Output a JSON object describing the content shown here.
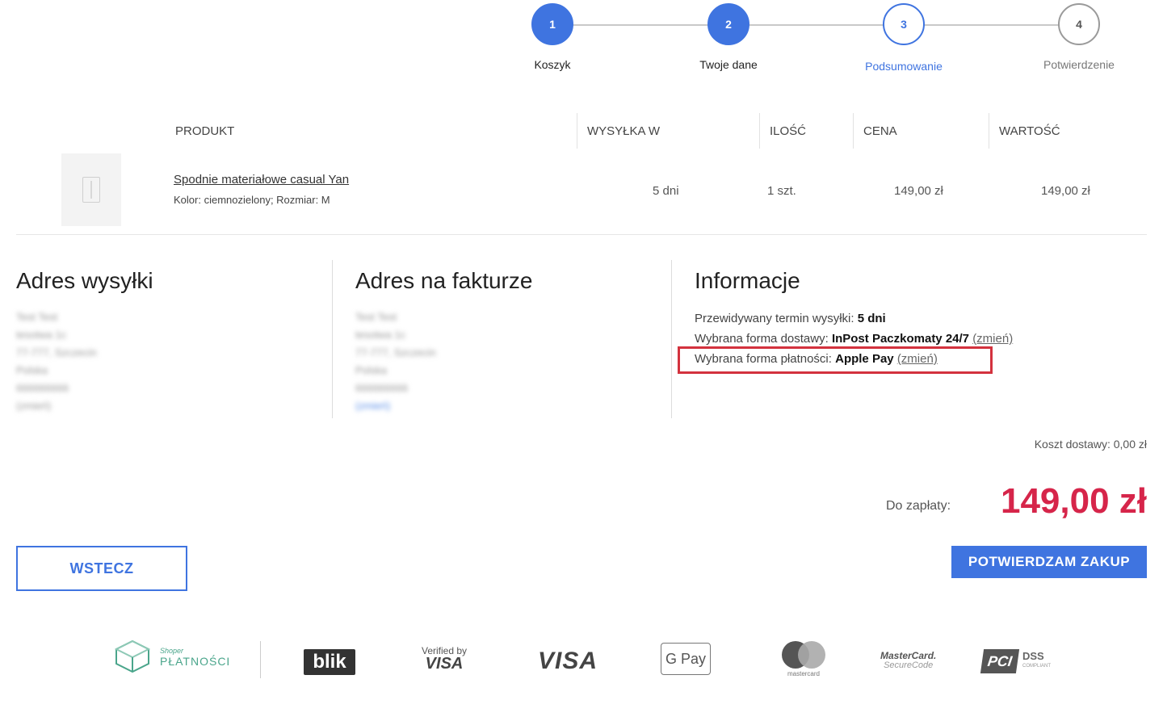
{
  "stepper": {
    "steps": [
      {
        "number": "1",
        "label": "Koszyk",
        "state": "done"
      },
      {
        "number": "2",
        "label": "Twoje dane",
        "state": "done"
      },
      {
        "number": "3",
        "label": "Podsumowanie",
        "state": "active"
      },
      {
        "number": "4",
        "label": "Potwierdzenie",
        "state": "todo"
      }
    ]
  },
  "table": {
    "headers": {
      "product": "PRODUKT",
      "shipping": "WYSYŁKA W",
      "quantity": "ILOŚĆ",
      "price": "CENA",
      "value": "WARTOŚĆ"
    },
    "rows": [
      {
        "name": "Spodnie materiałowe casual Yan",
        "attributes": "Kolor: ciemnozielony; Rozmiar: M",
        "shipping": "5 dni",
        "quantity": "1 szt.",
        "price": "149,00 zł",
        "value": "149,00 zł"
      }
    ]
  },
  "shipping_address": {
    "title": "Adres wysyłki",
    "lines": [
      "Test Test",
      "tesotwa 1c",
      "77-777, Szczecin",
      "Polska",
      "666666666",
      "(zmień)"
    ]
  },
  "billing_address": {
    "title": "Adres na fakturze",
    "lines": [
      "Test Test",
      "tesotwa 1c",
      "77-777, Szczecin",
      "Polska",
      "666666666"
    ],
    "change_link": "(zmień)"
  },
  "info": {
    "title": "Informacje",
    "eta_label": "Przewidywany termin wysyłki:",
    "eta_value": "5 dni",
    "delivery_label": "Wybrana forma dostawy:",
    "delivery_value": "InPost Paczkomaty 24/7",
    "delivery_change": "(zmień)",
    "payment_label": "Wybrana forma płatności:",
    "payment_value": "Apple Pay",
    "payment_change": "(zmień)",
    "highlight_color": "#d3323e"
  },
  "totals": {
    "shipping_cost": "Koszt dostawy: 0,00 zł",
    "due_label": "Do zapłaty:",
    "due_value": "149,00 zł",
    "due_color": "#d6254a"
  },
  "buttons": {
    "back": "WSTECZ",
    "confirm": "POTWIERDZAM ZAKUP",
    "accent": "#3f74e0"
  },
  "payment_logos": {
    "shoper_small": "Shoper",
    "shoper_big": "PŁATNOŚCI",
    "blik": "blik",
    "vbv_small": "Verified by",
    "vbv_big": "VISA",
    "visa": "VISA",
    "gpay": "G Pay",
    "mastercard": "mastercard",
    "mc_securecode_big": "MasterCard.",
    "mc_securecode_small": "SecureCode",
    "pci": "PCI",
    "dss": "DSS",
    "dss_small": "COMPLIANT"
  }
}
